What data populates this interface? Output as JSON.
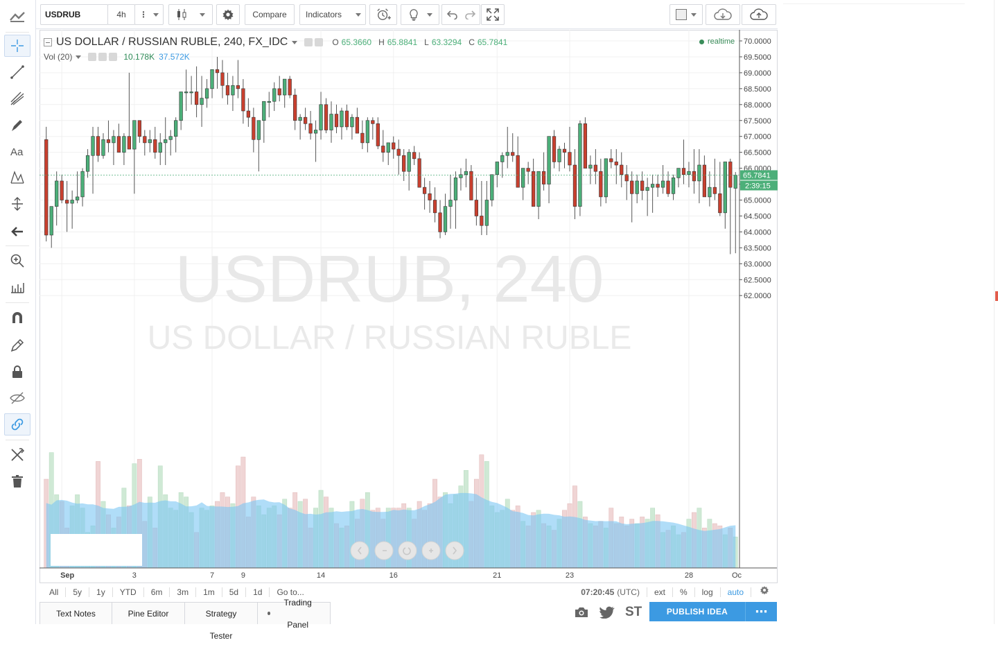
{
  "toolbar": {
    "symbol": "USDRUB",
    "interval": "4h",
    "compare_label": "Compare",
    "indicators_label": "Indicators"
  },
  "legend": {
    "title": "US DOLLAR / RUSSIAN RUBLE, 240, FX_IDC",
    "o_label": "O",
    "o_value": "65.3660",
    "h_label": "H",
    "h_value": "65.8841",
    "l_label": "L",
    "l_value": "63.3294",
    "c_label": "C",
    "c_value": "65.7841",
    "vol_label": "Vol (20)",
    "vol_value_1": "10.178K",
    "vol_value_2": "37.572K",
    "realtime": "realtime"
  },
  "watermark": {
    "symbol": "USDRUB, 240",
    "name": "US DOLLAR / RUSSIAN RUBLE"
  },
  "price_axis": {
    "labels": [
      "70.0000",
      "69.5000",
      "69.0000",
      "68.5000",
      "68.0000",
      "67.5000",
      "67.0000",
      "66.5000",
      "66.0000",
      "65.5000",
      "65.0000",
      "64.5000",
      "64.0000",
      "63.5000",
      "63.0000",
      "62.5000",
      "62.0000"
    ],
    "last_price": "65.7841",
    "countdown": "2:39:15"
  },
  "time_axis": {
    "labels": [
      "Sep",
      "3",
      "7",
      "9",
      "14",
      "16",
      "21",
      "23",
      "28",
      "Oc"
    ]
  },
  "range_bar": {
    "buttons": [
      "All",
      "5y",
      "1y",
      "YTD",
      "6m",
      "3m",
      "1m",
      "5d",
      "1d",
      "Go to..."
    ],
    "time": "07:20:45",
    "tz": "(UTC)",
    "ext": "ext",
    "percent": "%",
    "log": "log",
    "auto": "auto"
  },
  "bottom_tabs": [
    "Text Notes",
    "Pine Editor",
    "Strategy Tester",
    "Trading Panel"
  ],
  "publish": {
    "label": "PUBLISH IDEA",
    "more": "⋯",
    "st": "ST"
  },
  "colors": {
    "up": "#4caf79",
    "down": "#c9402f",
    "vol_up": "#cfe9d5",
    "vol_down": "#f0d5d5",
    "vol_ma_fill": "#7cc7f4",
    "accent": "#3c9ae2",
    "price_tag": "#4caf79"
  },
  "chart_data": {
    "type": "candlestick",
    "symbol": "USDRUB",
    "interval": "240",
    "ylim": [
      61.7,
      70.2
    ],
    "series": [
      {
        "name": "price",
        "ohlc": [
          [
            66.9,
            67.3,
            63.7,
            63.9
          ],
          [
            63.9,
            64.1,
            63.5,
            64.8
          ],
          [
            64.8,
            65.9,
            64.2,
            65.6
          ],
          [
            65.6,
            65.8,
            64.9,
            65.0
          ],
          [
            65.0,
            65.6,
            64.0,
            64.9
          ],
          [
            64.9,
            65.3,
            64.1,
            65.0
          ],
          [
            65.0,
            65.9,
            64.9,
            65.1
          ],
          [
            65.1,
            66.0,
            64.8,
            65.9
          ],
          [
            65.9,
            66.6,
            65.7,
            66.4
          ],
          [
            66.4,
            67.3,
            65.2,
            67.0
          ],
          [
            67.0,
            67.3,
            66.2,
            66.4
          ],
          [
            66.4,
            67.1,
            66.3,
            66.9
          ],
          [
            66.9,
            67.5,
            66.5,
            66.8
          ],
          [
            66.8,
            67.2,
            66.1,
            67.0
          ],
          [
            67.0,
            67.4,
            66.6,
            66.5
          ],
          [
            66.5,
            67.1,
            66.1,
            67.0
          ],
          [
            67.0,
            69.0,
            66.8,
            66.6
          ],
          [
            66.6,
            67.4,
            65.2,
            67.5
          ],
          [
            67.5,
            67.5,
            66.8,
            67.0
          ],
          [
            67.0,
            67.2,
            66.4,
            66.8
          ],
          [
            66.8,
            67.2,
            66.5,
            66.9
          ],
          [
            66.9,
            67.3,
            66.3,
            66.5
          ],
          [
            66.5,
            67.1,
            66.1,
            66.8
          ],
          [
            66.8,
            67.6,
            66.1,
            66.9
          ],
          [
            66.9,
            67.2,
            66.4,
            67.0
          ],
          [
            67.0,
            67.6,
            66.5,
            67.5
          ],
          [
            67.5,
            68.0,
            67.2,
            68.4
          ],
          [
            68.4,
            69.1,
            67.8,
            68.4
          ],
          [
            68.4,
            68.9,
            68.0,
            68.4
          ],
          [
            68.4,
            69.2,
            67.6,
            68.0
          ],
          [
            68.0,
            68.9,
            67.3,
            68.2
          ],
          [
            68.2,
            68.8,
            67.9,
            68.5
          ],
          [
            68.5,
            69.1,
            68.2,
            69.1
          ],
          [
            69.1,
            69.5,
            68.5,
            69.0
          ],
          [
            69.0,
            69.4,
            68.2,
            68.6
          ],
          [
            68.6,
            69.0,
            68.0,
            68.3
          ],
          [
            68.3,
            68.9,
            67.8,
            68.6
          ],
          [
            68.6,
            69.4,
            68.2,
            68.5
          ],
          [
            68.5,
            68.8,
            67.4,
            67.8
          ],
          [
            67.8,
            68.2,
            67.3,
            67.6
          ],
          [
            67.6,
            67.9,
            66.5,
            66.9
          ],
          [
            66.9,
            67.4,
            65.9,
            67.5
          ],
          [
            67.5,
            68.0,
            66.8,
            68.1
          ],
          [
            68.1,
            68.4,
            67.6,
            68.1
          ],
          [
            68.1,
            68.7,
            67.8,
            68.5
          ],
          [
            68.5,
            68.9,
            68.1,
            68.3
          ],
          [
            68.3,
            68.7,
            67.9,
            68.8
          ],
          [
            68.8,
            68.9,
            68.2,
            68.3
          ],
          [
            68.3,
            68.5,
            67.2,
            67.5
          ],
          [
            67.5,
            67.7,
            66.9,
            67.6
          ],
          [
            67.6,
            67.9,
            67.2,
            67.4
          ],
          [
            67.4,
            67.8,
            66.9,
            67.1
          ],
          [
            67.1,
            67.5,
            66.2,
            67.2
          ],
          [
            67.2,
            68.4,
            66.9,
            68.0
          ],
          [
            68.0,
            68.2,
            67.1,
            67.2
          ],
          [
            67.2,
            68.1,
            66.8,
            67.7
          ],
          [
            67.7,
            68.0,
            67.1,
            67.3
          ],
          [
            67.3,
            67.9,
            66.9,
            67.8
          ],
          [
            67.8,
            68.0,
            67.2,
            67.3
          ],
          [
            67.3,
            67.7,
            66.9,
            67.6
          ],
          [
            67.6,
            67.9,
            67.3,
            67.1
          ],
          [
            67.1,
            67.5,
            66.6,
            66.8
          ],
          [
            66.8,
            67.6,
            66.5,
            67.5
          ],
          [
            67.5,
            67.6,
            66.9,
            67.4
          ],
          [
            67.4,
            67.6,
            66.6,
            66.7
          ],
          [
            66.7,
            67.2,
            66.2,
            66.5
          ],
          [
            66.5,
            66.8,
            66.1,
            66.8
          ],
          [
            66.8,
            67.0,
            66.3,
            66.6
          ],
          [
            66.6,
            66.9,
            65.8,
            66.4
          ],
          [
            66.4,
            66.6,
            65.6,
            65.9
          ],
          [
            65.9,
            66.6,
            65.3,
            66.5
          ],
          [
            66.5,
            66.7,
            66.1,
            66.3
          ],
          [
            66.3,
            66.5,
            65.4,
            65.4
          ],
          [
            65.4,
            65.7,
            64.7,
            65.2
          ],
          [
            65.2,
            65.6,
            64.6,
            65.0
          ],
          [
            65.0,
            65.4,
            64.3,
            64.6
          ],
          [
            64.6,
            65.0,
            63.8,
            64.0
          ],
          [
            64.0,
            65.2,
            63.9,
            64.8
          ],
          [
            64.8,
            65.8,
            64.1,
            65.0
          ],
          [
            65.0,
            65.9,
            64.1,
            65.7
          ],
          [
            65.7,
            66.0,
            65.3,
            65.8
          ],
          [
            65.8,
            66.3,
            65.4,
            65.9
          ],
          [
            65.9,
            66.1,
            65.4,
            65.0
          ],
          [
            65.0,
            65.7,
            64.2,
            64.5
          ],
          [
            64.5,
            65.6,
            63.9,
            64.2
          ],
          [
            64.2,
            65.6,
            63.9,
            65.0
          ],
          [
            65.0,
            65.7,
            64.8,
            65.8
          ],
          [
            65.8,
            66.2,
            65.4,
            66.2
          ],
          [
            66.2,
            66.5,
            65.7,
            66.4
          ],
          [
            66.4,
            67.3,
            66.0,
            66.5
          ],
          [
            66.5,
            67.1,
            66.2,
            66.4
          ],
          [
            66.4,
            67.0,
            65.8,
            65.4
          ],
          [
            65.4,
            66.0,
            65.0,
            66.0
          ],
          [
            66.0,
            66.2,
            65.5,
            65.9
          ],
          [
            65.9,
            66.3,
            64.9,
            64.8
          ],
          [
            64.8,
            65.8,
            64.4,
            65.9
          ],
          [
            65.9,
            66.5,
            65.3,
            65.5
          ],
          [
            65.5,
            66.6,
            64.9,
            67.0
          ],
          [
            67.0,
            67.2,
            66.0,
            66.2
          ],
          [
            66.2,
            66.7,
            65.9,
            66.6
          ],
          [
            66.6,
            66.8,
            66.0,
            66.5
          ],
          [
            66.5,
            67.3,
            65.9,
            66.1
          ],
          [
            66.1,
            66.6,
            64.4,
            64.8
          ],
          [
            64.8,
            67.5,
            64.5,
            67.4
          ],
          [
            67.4,
            67.6,
            66.3,
            66.0
          ],
          [
            66.0,
            66.4,
            65.5,
            66.1
          ],
          [
            66.1,
            66.6,
            65.5,
            65.9
          ],
          [
            65.9,
            66.3,
            64.8,
            65.1
          ],
          [
            65.1,
            66.1,
            64.9,
            66.3
          ],
          [
            66.3,
            66.6,
            66.0,
            66.2
          ],
          [
            66.2,
            66.6,
            65.5,
            66.1
          ],
          [
            66.1,
            66.5,
            65.4,
            65.8
          ],
          [
            65.8,
            66.1,
            65.0,
            65.6
          ],
          [
            65.6,
            65.9,
            64.3,
            65.2
          ],
          [
            65.2,
            65.8,
            64.9,
            65.6
          ],
          [
            65.6,
            65.9,
            65.0,
            65.3
          ],
          [
            65.3,
            65.7,
            64.5,
            65.4
          ],
          [
            65.4,
            65.8,
            64.6,
            65.5
          ],
          [
            65.5,
            65.8,
            65.1,
            65.4
          ],
          [
            65.4,
            66.1,
            65.2,
            65.6
          ],
          [
            65.6,
            65.9,
            65.1,
            65.2
          ],
          [
            65.2,
            65.8,
            65.0,
            65.7
          ],
          [
            65.7,
            66.0,
            65.4,
            66.0
          ],
          [
            66.0,
            66.9,
            65.5,
            65.8
          ],
          [
            65.8,
            66.2,
            65.4,
            65.9
          ],
          [
            65.9,
            66.6,
            65.2,
            65.6
          ],
          [
            65.6,
            66.6,
            64.9,
            66.1
          ],
          [
            66.1,
            66.4,
            65.2,
            65.1
          ],
          [
            65.1,
            65.9,
            64.8,
            65.4
          ],
          [
            65.4,
            66.3,
            65.0,
            65.2
          ],
          [
            65.2,
            66.2,
            64.5,
            64.6
          ],
          [
            64.6,
            66.2,
            64.1,
            66.2
          ],
          [
            66.2,
            66.3,
            63.3,
            65.4
          ],
          [
            65.37,
            65.88,
            63.33,
            65.78
          ]
        ]
      },
      {
        "name": "Vol (20)",
        "values": [
          40,
          52,
          33,
          30,
          18,
          28,
          33,
          27,
          16,
          19,
          48,
          30,
          24,
          18,
          23,
          36,
          28,
          47,
          49,
          21,
          32,
          18,
          46,
          33,
          27,
          26,
          34,
          32,
          25,
          16,
          27,
          26,
          28,
          30,
          34,
          32,
          29,
          46,
          50,
          23,
          32,
          28,
          24,
          27,
          28,
          24,
          31,
          27,
          34,
          30,
          31,
          18,
          27,
          35,
          32,
          27,
          20,
          18,
          19,
          30,
          22,
          31,
          34,
          26,
          27,
          22,
          27,
          27,
          27,
          29,
          27,
          22,
          30,
          26,
          29,
          40,
          32,
          34,
          29,
          33,
          37,
          44,
          30,
          40,
          51,
          48,
          28,
          25,
          26,
          31,
          26,
          28,
          21,
          19,
          25,
          26,
          20,
          19,
          17,
          22,
          26,
          29,
          37,
          30,
          23,
          20,
          19,
          21,
          18,
          27,
          20,
          23,
          19,
          22,
          20,
          23,
          22,
          27,
          24,
          16,
          17,
          19,
          15,
          16,
          22,
          25,
          27,
          18,
          22,
          20,
          19,
          15,
          18,
          14
        ]
      }
    ]
  }
}
